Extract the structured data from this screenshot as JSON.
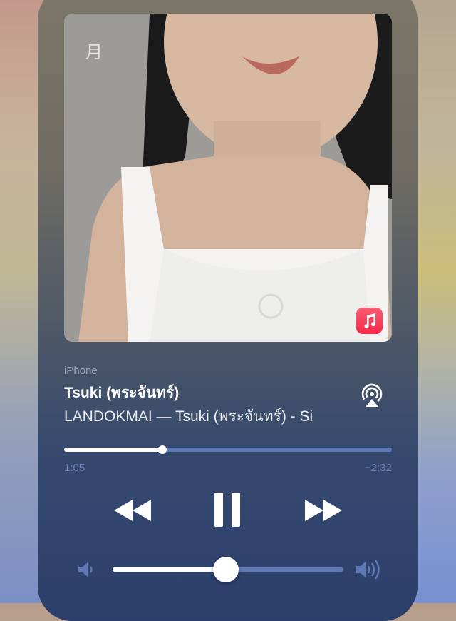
{
  "player": {
    "source_device": "iPhone",
    "track_title": "Tsuki (พระจันทร์)",
    "subtitle": "LANDOKMAI — Tsuki (พระจันทร์) - Si",
    "elapsed": "1:05",
    "remaining": "−2:32",
    "progress_fraction": 0.3,
    "volume_fraction": 0.49
  },
  "artwork": {
    "logo_text": "月"
  },
  "icons": {
    "app_badge": "apple-music-icon",
    "airplay": "airplay-icon",
    "rewind": "rewind-icon",
    "pause": "pause-icon",
    "forward": "fast-forward-icon",
    "volume_low": "speaker-low-icon",
    "volume_high": "speaker-high-icon"
  },
  "colors": {
    "accent": "#5f78b6",
    "badge": "#f62a48"
  }
}
